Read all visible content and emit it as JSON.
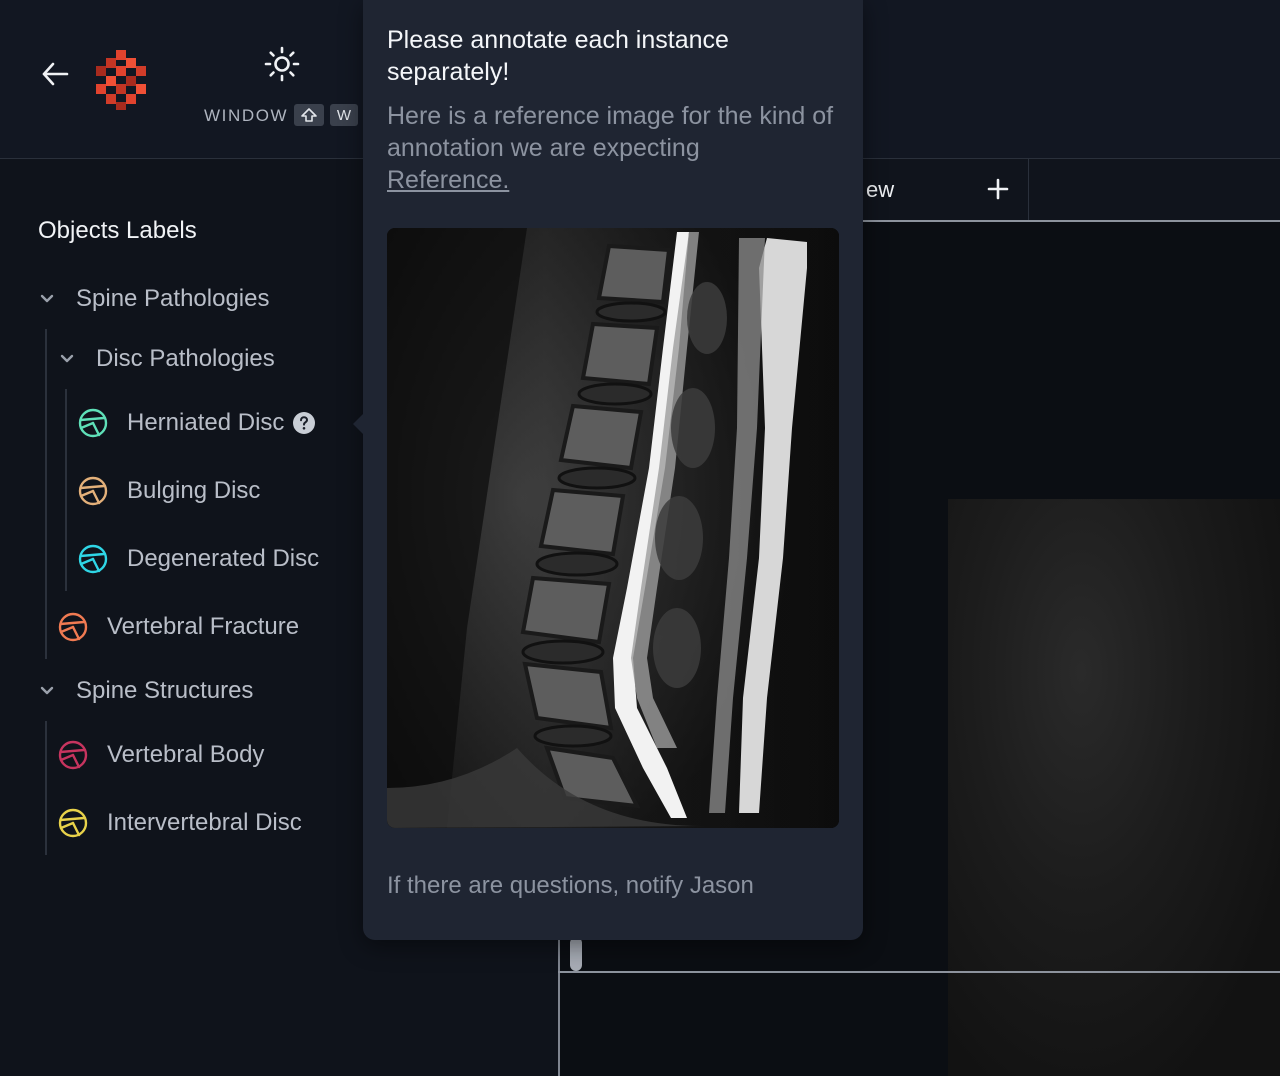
{
  "toolbar": {
    "window_label": "WINDOW",
    "window_key": "W"
  },
  "sidebar": {
    "title": "Objects Labels",
    "groups": [
      {
        "label": "Spine Pathologies",
        "subgroup": {
          "label": "Disc Pathologies",
          "items": [
            {
              "label": "Herniated Disc",
              "color": "#5fe0b8"
            },
            {
              "label": "Bulging Disc",
              "color": "#e3b07a"
            },
            {
              "label": "Degenerated Disc",
              "color": "#2fd6e6"
            }
          ]
        },
        "items": [
          {
            "label": "Vertebral Fracture",
            "color": "#f07a52"
          }
        ]
      },
      {
        "label": "Spine Structures",
        "items": [
          {
            "label": "Vertebral Body",
            "color": "#c7345f"
          },
          {
            "label": "Intervertebral Disc",
            "color": "#e8d24a"
          }
        ]
      }
    ]
  },
  "viewer": {
    "tab_partial_label": "ew"
  },
  "popover": {
    "title": "Please annotate each instance separately!",
    "description": "Here is a reference image for the kind of annotation we are expecting",
    "link": "Reference.",
    "footer": "If there are questions, notify Jason"
  }
}
